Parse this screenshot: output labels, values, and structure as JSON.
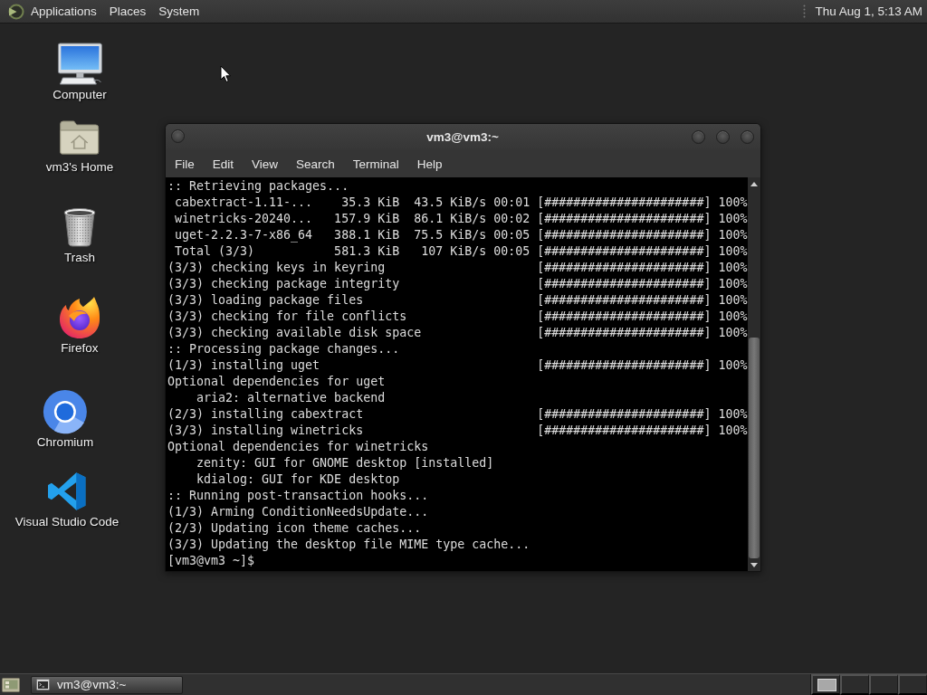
{
  "top_panel": {
    "menus": [
      "Applications",
      "Places",
      "System"
    ],
    "clock": "Thu Aug 1, 5:13 AM"
  },
  "desktop": {
    "icons": [
      {
        "label": "Computer",
        "kind": "computer"
      },
      {
        "label": "vm3's Home",
        "kind": "home"
      },
      {
        "label": "Trash",
        "kind": "trash"
      },
      {
        "label": "Firefox",
        "kind": "firefox"
      },
      {
        "label": "Chromium",
        "kind": "chromium"
      },
      {
        "label": "Visual Studio Code",
        "kind": "vscode"
      }
    ]
  },
  "terminal_window": {
    "title": "vm3@vm3:~",
    "menu": [
      "File",
      "Edit",
      "View",
      "Search",
      "Terminal",
      "Help"
    ],
    "lines": [
      {
        "text": ":: Retrieving packages..."
      },
      {
        "text": " cabextract-1.11-...    35.3 KiB  43.5 KiB/s 00:01",
        "bar": "[######################]",
        "percent": "100%"
      },
      {
        "text": " winetricks-20240...   157.9 KiB  86.1 KiB/s 00:02",
        "bar": "[######################]",
        "percent": "100%"
      },
      {
        "text": " uget-2.2.3-7-x86_64   388.1 KiB  75.5 KiB/s 00:05",
        "bar": "[######################]",
        "percent": "100%"
      },
      {
        "text": " Total (3/3)           581.3 KiB   107 KiB/s 00:05",
        "bar": "[######################]",
        "percent": "100%"
      },
      {
        "text": "(3/3) checking keys in keyring",
        "bar": "[######################]",
        "percent": "100%"
      },
      {
        "text": "(3/3) checking package integrity",
        "bar": "[######################]",
        "percent": "100%"
      },
      {
        "text": "(3/3) loading package files",
        "bar": "[######################]",
        "percent": "100%"
      },
      {
        "text": "(3/3) checking for file conflicts",
        "bar": "[######################]",
        "percent": "100%"
      },
      {
        "text": "(3/3) checking available disk space",
        "bar": "[######################]",
        "percent": "100%"
      },
      {
        "text": ":: Processing package changes..."
      },
      {
        "text": "(1/3) installing uget",
        "bar": "[######################]",
        "percent": "100%"
      },
      {
        "text": "Optional dependencies for uget"
      },
      {
        "text": "    aria2: alternative backend"
      },
      {
        "text": "(2/3) installing cabextract",
        "bar": "[######################]",
        "percent": "100%"
      },
      {
        "text": "(3/3) installing winetricks",
        "bar": "[######################]",
        "percent": "100%"
      },
      {
        "text": "Optional dependencies for winetricks"
      },
      {
        "text": "    zenity: GUI for GNOME desktop [installed]"
      },
      {
        "text": "    kdialog: GUI for KDE desktop"
      },
      {
        "text": ":: Running post-transaction hooks..."
      },
      {
        "text": "(1/3) Arming ConditionNeedsUpdate..."
      },
      {
        "text": "(2/3) Updating icon theme caches..."
      },
      {
        "text": "(3/3) Updating the desktop file MIME type cache..."
      },
      {
        "text": "[vm3@vm3 ~]$"
      }
    ]
  },
  "bottom_panel": {
    "tasks": [
      {
        "label": "vm3@vm3:~",
        "selected": true
      }
    ],
    "workspaces": [
      {
        "has_window": true
      },
      {
        "has_window": false
      },
      {
        "has_window": false
      },
      {
        "has_window": false
      }
    ]
  }
}
